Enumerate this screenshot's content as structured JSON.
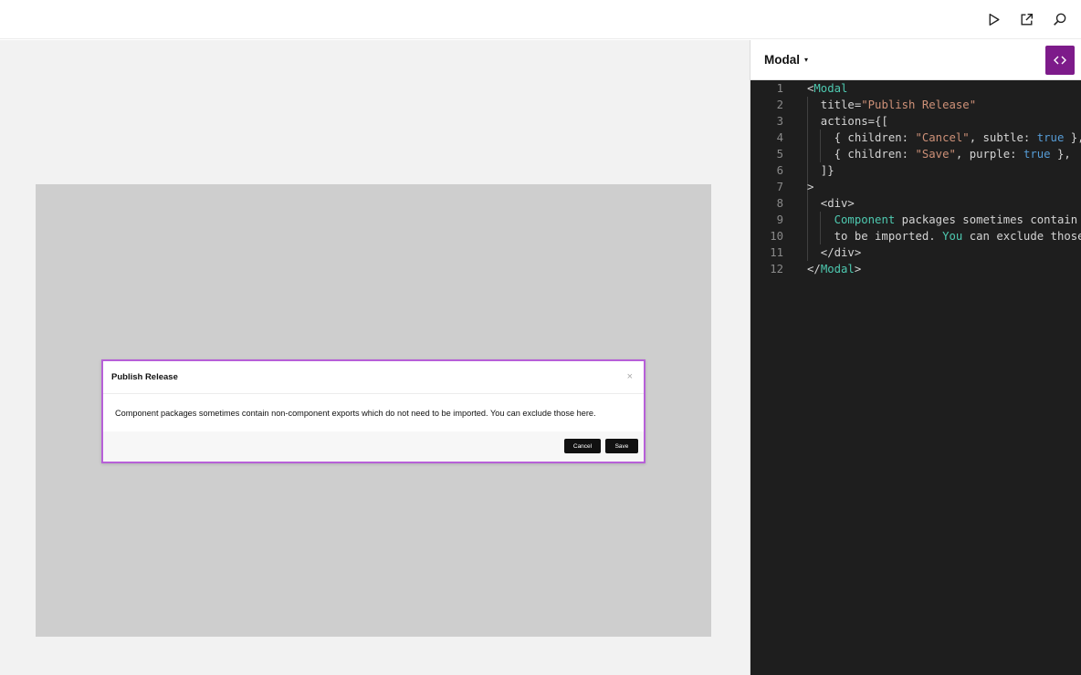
{
  "toolbar": {
    "icons": [
      "play-icon",
      "open-external-icon",
      "search-icon"
    ]
  },
  "preview": {
    "modal": {
      "title": "Publish Release",
      "close_glyph": "×",
      "body": "Component packages sometimes contain non-component exports which do not need to be imported. You can exclude those here.",
      "cancel_label": "Cancel",
      "save_label": "Save"
    }
  },
  "panel": {
    "component_name": "Modal",
    "caret": "▾",
    "code_toggle_icon": "code-icon"
  },
  "code": {
    "lines": [
      {
        "num": "1",
        "tokens": [
          {
            "t": "<"
          },
          {
            "t": "Modal",
            "c": "tag"
          }
        ]
      },
      {
        "num": "2",
        "tokens": [
          {
            "t": "  title="
          },
          {
            "t": "\"Publish Release\"",
            "c": "str"
          }
        ]
      },
      {
        "num": "3",
        "tokens": [
          {
            "t": "  actions={["
          }
        ]
      },
      {
        "num": "4",
        "tokens": [
          {
            "t": "    { children: "
          },
          {
            "t": "\"Cancel\"",
            "c": "str"
          },
          {
            "t": ", subtle: "
          },
          {
            "t": "true",
            "c": "kw"
          },
          {
            "t": " },"
          }
        ]
      },
      {
        "num": "5",
        "tokens": [
          {
            "t": "    { children: "
          },
          {
            "t": "\"Save\"",
            "c": "str"
          },
          {
            "t": ", purple: "
          },
          {
            "t": "true",
            "c": "kw"
          },
          {
            "t": " },"
          }
        ]
      },
      {
        "num": "6",
        "tokens": [
          {
            "t": "  ]}"
          }
        ]
      },
      {
        "num": "7",
        "tokens": [
          {
            "t": ">"
          }
        ]
      },
      {
        "num": "8",
        "tokens": [
          {
            "t": "  <div>"
          }
        ]
      },
      {
        "num": "9",
        "tokens": [
          {
            "t": "    "
          },
          {
            "t": "Component",
            "c": "id"
          },
          {
            "t": " packages sometimes contain n"
          }
        ]
      },
      {
        "num": "10",
        "tokens": [
          {
            "t": "    to be imported. "
          },
          {
            "t": "You",
            "c": "id"
          },
          {
            "t": " can exclude those"
          }
        ]
      },
      {
        "num": "11",
        "tokens": [
          {
            "t": "  </div>"
          }
        ]
      },
      {
        "num": "12",
        "tokens": [
          {
            "t": "</"
          },
          {
            "t": "Modal",
            "c": "tag"
          },
          {
            "t": ">"
          }
        ]
      }
    ]
  },
  "colors": {
    "accent_purple": "#7d1b8a",
    "selection_outline": "#b760d8",
    "editor_bg": "#1e1e1e",
    "canvas_bg": "#f2f2f2",
    "frame_bg": "#cecece"
  }
}
